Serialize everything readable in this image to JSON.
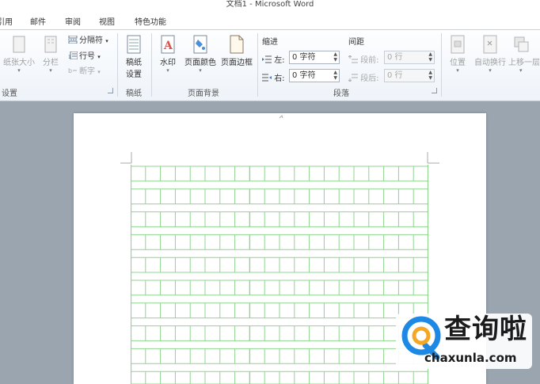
{
  "window": {
    "title": "文档1 - Microsoft Word"
  },
  "tabs": [
    "引用",
    "邮件",
    "审阅",
    "视图",
    "特色功能"
  ],
  "ribbon": {
    "page_setup": {
      "paper_size": "纸张大小",
      "columns": "分栏",
      "breaks": "分隔符",
      "line_numbers": "行号",
      "hyphenation": "断字",
      "group_label": "设置"
    },
    "manuscript": {
      "setup_line1": "稿纸",
      "setup_line2": "设置",
      "group_label": "稿纸"
    },
    "page_background": {
      "watermark": "水印",
      "page_color": "页面颜色",
      "page_borders": "页面边框",
      "group_label": "页面背景"
    },
    "paragraph": {
      "indent_header": "缩进",
      "spacing_header": "间距",
      "left_label": "左:",
      "left_value": "0 字符",
      "right_label": "右:",
      "right_value": "0 字符",
      "before_label": "段前:",
      "before_value": "0 行",
      "after_label": "段后:",
      "after_value": "0 行",
      "group_label": "段落"
    },
    "arrange": {
      "position": "位置",
      "wrap_text": "自动换行",
      "bring_forward": "上移一层"
    }
  },
  "watermark_logo": {
    "brand_text": "查询啦",
    "url_text": "chaxunla.com",
    "brand_color": "#1e88e5",
    "accent_color": "#f5a623"
  },
  "colors": {
    "grid_line": "#8fd48f",
    "ribbon_bg": "#eef3f9",
    "doc_bg": "#9ba5b0"
  }
}
